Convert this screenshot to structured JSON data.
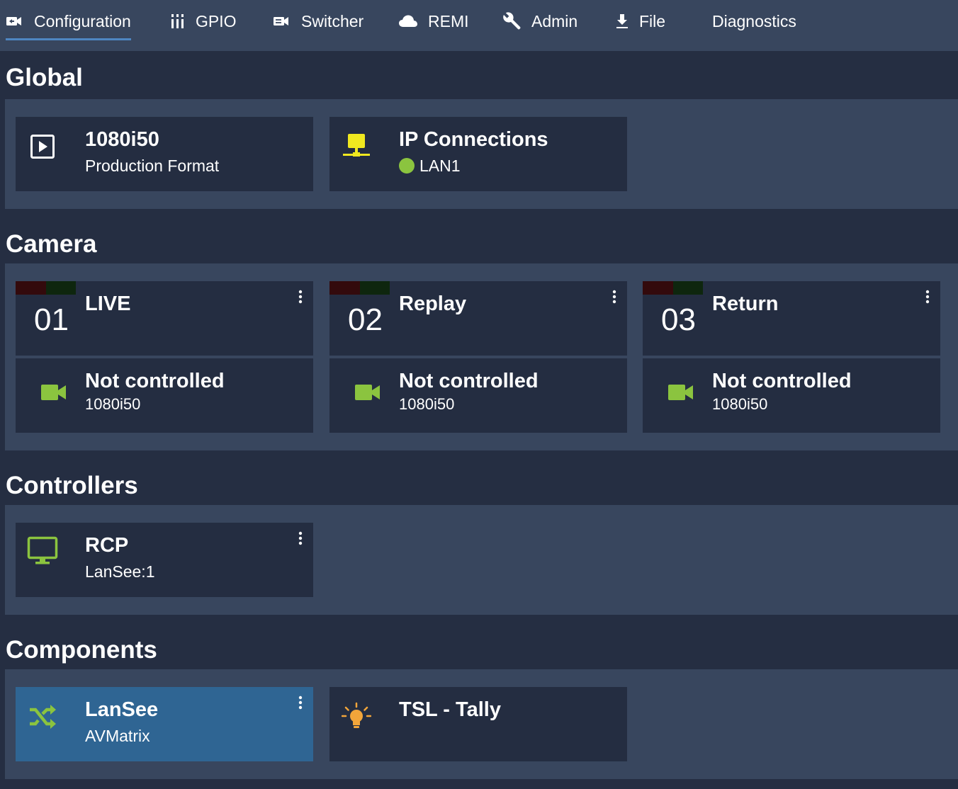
{
  "nav": {
    "items": [
      {
        "label": "Configuration",
        "icon": "camera-switch-icon",
        "active": true
      },
      {
        "label": "GPIO",
        "icon": "gpio-icon",
        "active": false
      },
      {
        "label": "Switcher",
        "icon": "switcher-icon",
        "active": false
      },
      {
        "label": "REMI",
        "icon": "cloud-icon",
        "active": false
      },
      {
        "label": "Admin",
        "icon": "wrench-icon",
        "active": false
      },
      {
        "label": "File",
        "icon": "download-icon",
        "active": false
      },
      {
        "label": "Diagnostics",
        "icon": "",
        "active": false
      }
    ]
  },
  "sections": {
    "global": {
      "title": "Global",
      "cards": [
        {
          "title": "1080i50",
          "subtitle": "Production Format",
          "icon": "play-box-icon"
        },
        {
          "title": "IP Connections",
          "subtitle": "LAN1",
          "icon": "network-icon",
          "status_color": "#8bc43f"
        }
      ]
    },
    "camera": {
      "title": "Camera",
      "cameras": [
        {
          "number": "01",
          "name": "LIVE",
          "control": "Not controlled",
          "format": "1080i50"
        },
        {
          "number": "02",
          "name": "Replay",
          "control": "Not controlled",
          "format": "1080i50"
        },
        {
          "number": "03",
          "name": "Return",
          "control": "Not controlled",
          "format": "1080i50"
        }
      ]
    },
    "controllers": {
      "title": "Controllers",
      "cards": [
        {
          "title": "RCP",
          "subtitle": "LanSee:1",
          "icon": "monitor-icon"
        }
      ]
    },
    "components": {
      "title": "Components",
      "cards": [
        {
          "title": "LanSee",
          "subtitle": "AVMatrix",
          "icon": "shuffle-icon",
          "selected": true
        },
        {
          "title": "TSL - Tally",
          "subtitle": "",
          "icon": "lightbulb-icon"
        }
      ]
    }
  },
  "colors": {
    "background": "#252e42",
    "panel": "#38465e",
    "card": "#242d41",
    "selected_card": "#2f6593",
    "accent_green": "#8bc43f",
    "accent_yellow": "#f0e81f",
    "accent_orange": "#f2a53a",
    "nav_underline": "#4e86c2"
  }
}
